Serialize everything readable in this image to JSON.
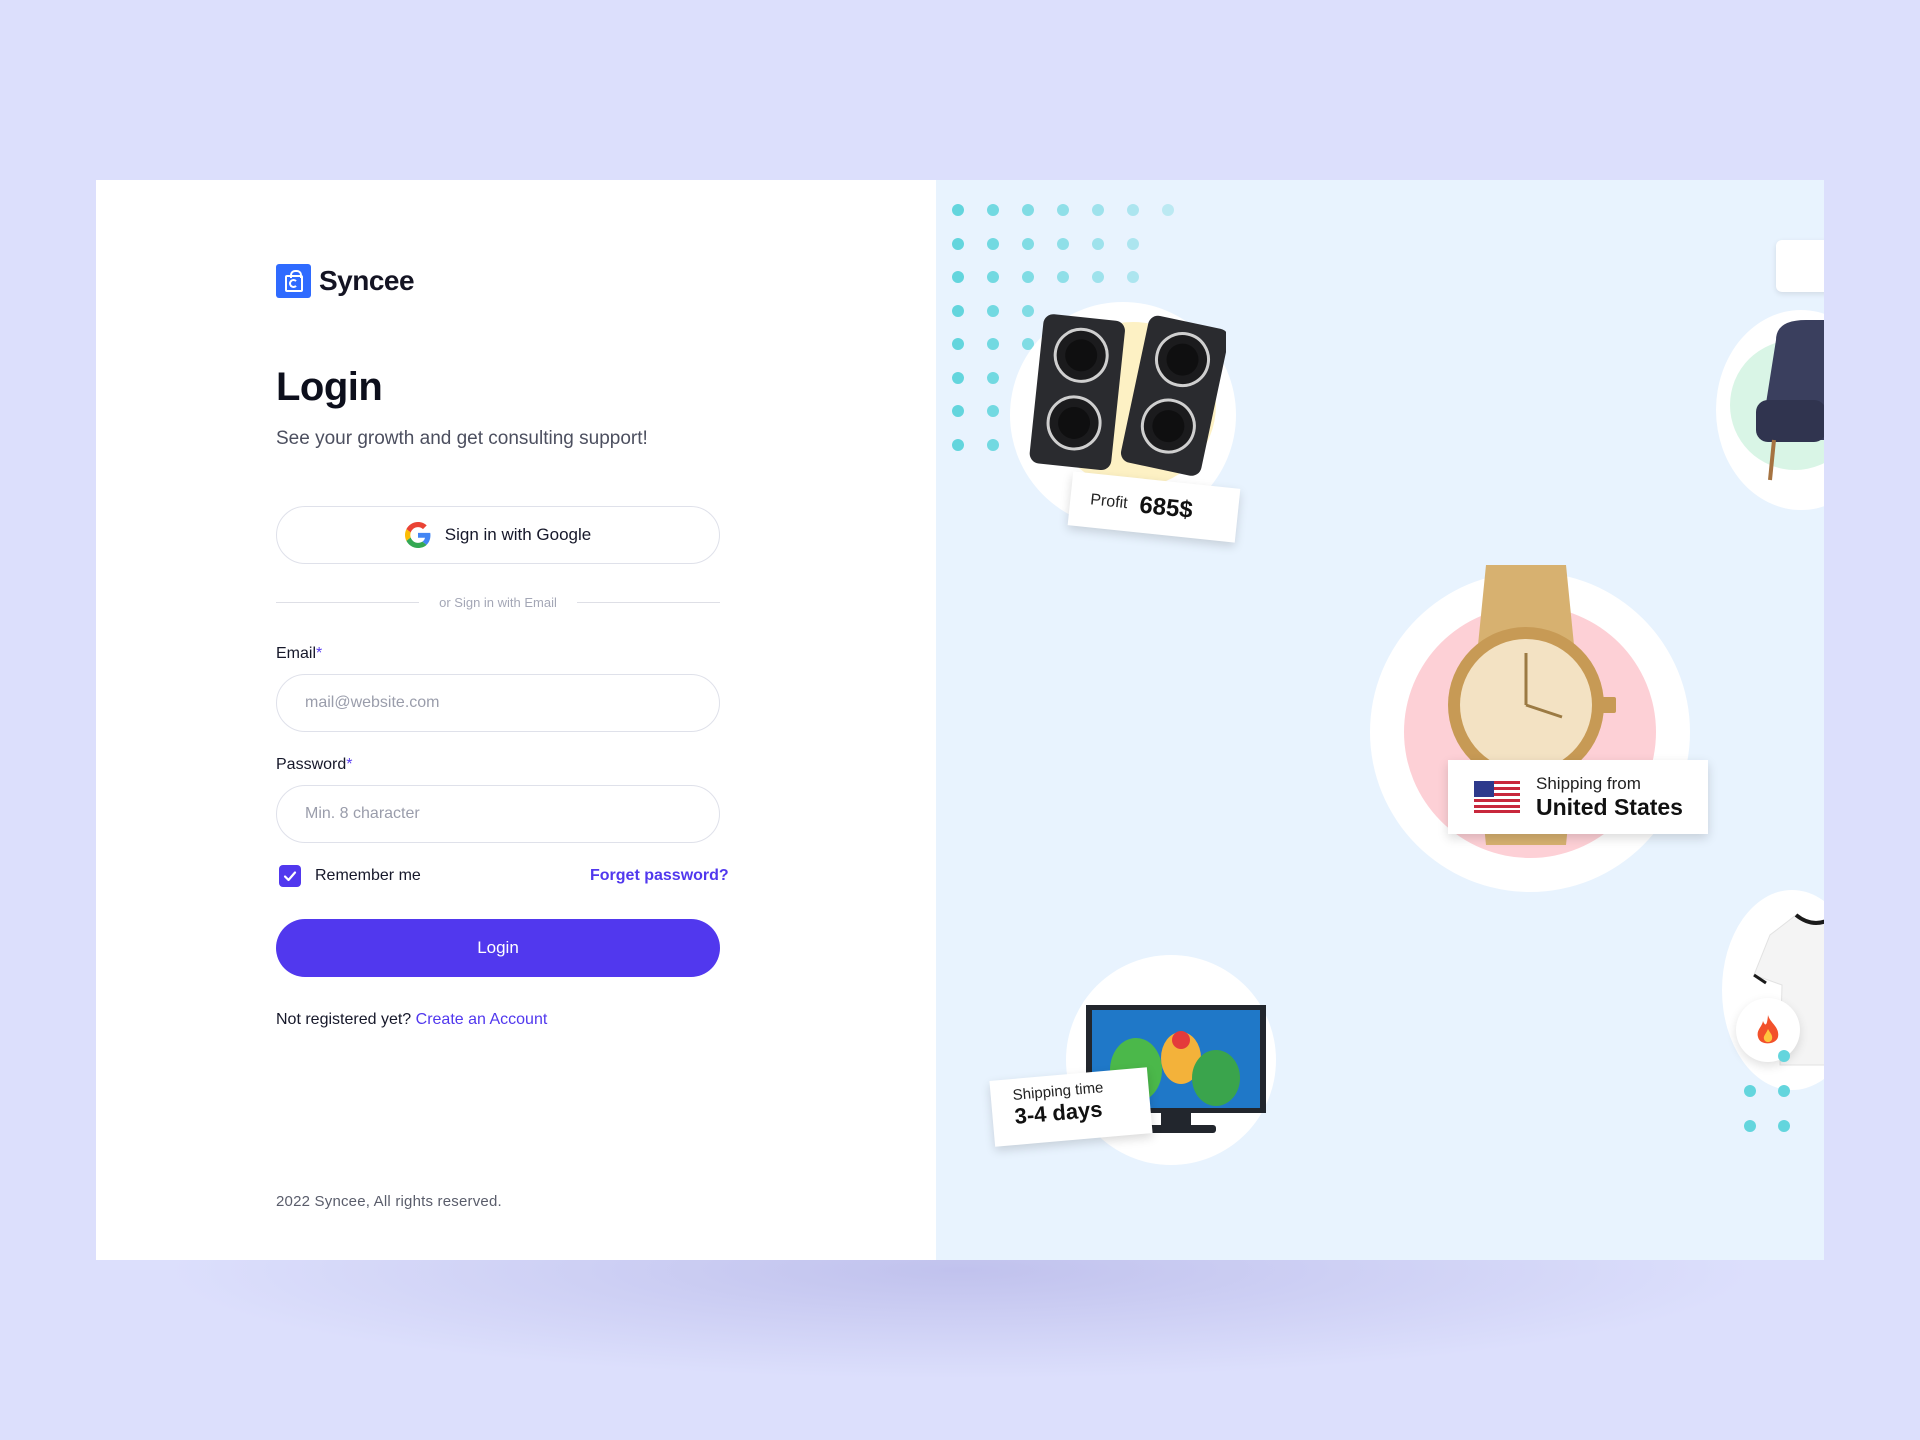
{
  "brand": {
    "name": "Syncee"
  },
  "login": {
    "title": "Login",
    "subtitle": "See your growth and get consulting support!",
    "google_label": "Sign in with Google",
    "divider_text": "or Sign in with Email",
    "email_label": "Email",
    "email_placeholder": "mail@website.com",
    "password_label": "Password",
    "password_placeholder": "Min. 8 character",
    "required_mark": "*",
    "remember_label": "Remember me",
    "remember_checked": true,
    "forgot_label": "Forget password?",
    "submit_label": "Login",
    "register_prompt": "Not registered yet?",
    "register_link": "Create an Account",
    "footer": "2022 Syncee, All rights reserved."
  },
  "promo": {
    "profit_label": "Profit",
    "profit_value": "685$",
    "shipping_from_label": "Shipping from",
    "shipping_from_value": "United States",
    "shipping_time_label": "Shipping time",
    "shipping_time_value": "3-4 days",
    "products": [
      "speakers",
      "watch",
      "armchair",
      "t-shirt",
      "tv"
    ]
  },
  "colors": {
    "accent": "#5138ee",
    "brand": "#2f6bff",
    "page_bg": "#dcdffc",
    "illustration_bg": "#e8f3fe",
    "dot": "#63d5dd"
  }
}
